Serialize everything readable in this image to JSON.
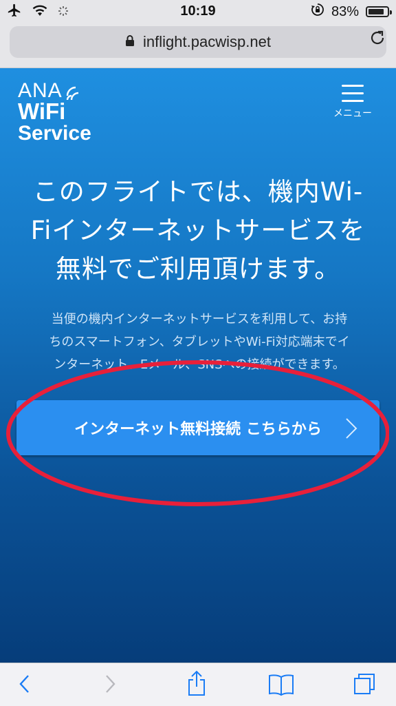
{
  "status_bar": {
    "time": "10:19",
    "battery": "83%"
  },
  "browser": {
    "url": "inflight.pacwisp.net"
  },
  "header": {
    "logo": {
      "line1": "ANA",
      "line2": "WiFi",
      "line3": "Service"
    },
    "menu_label": "メニュー"
  },
  "main": {
    "headline_lines": [
      "このフライトでは、機内Wi-",
      "Fiインターネットサービスを",
      "無料でご利用頂けます。"
    ],
    "description_lines": [
      "当便の機内インターネットサービスを利用して、お持",
      "ちのスマートフォン、タブレットやWi-Fi対応端末でイ",
      "ンターネット、Eメール、SNSへの接続ができます。"
    ],
    "cta_label": "インターネット無料接続 こちらから"
  },
  "colors": {
    "accent": "#2b8ff0",
    "page_top": "#1f8fe0",
    "page_bottom": "#063d7a",
    "annotation": "#e8203a"
  },
  "icons": [
    "airplane-icon",
    "wifi-icon",
    "activity-icon",
    "lock-icon",
    "reload-icon",
    "orientation-lock-icon",
    "battery-icon",
    "menu-icon",
    "chevron-right-icon",
    "back-icon",
    "forward-icon",
    "share-icon",
    "bookmarks-icon",
    "tabs-icon"
  ]
}
